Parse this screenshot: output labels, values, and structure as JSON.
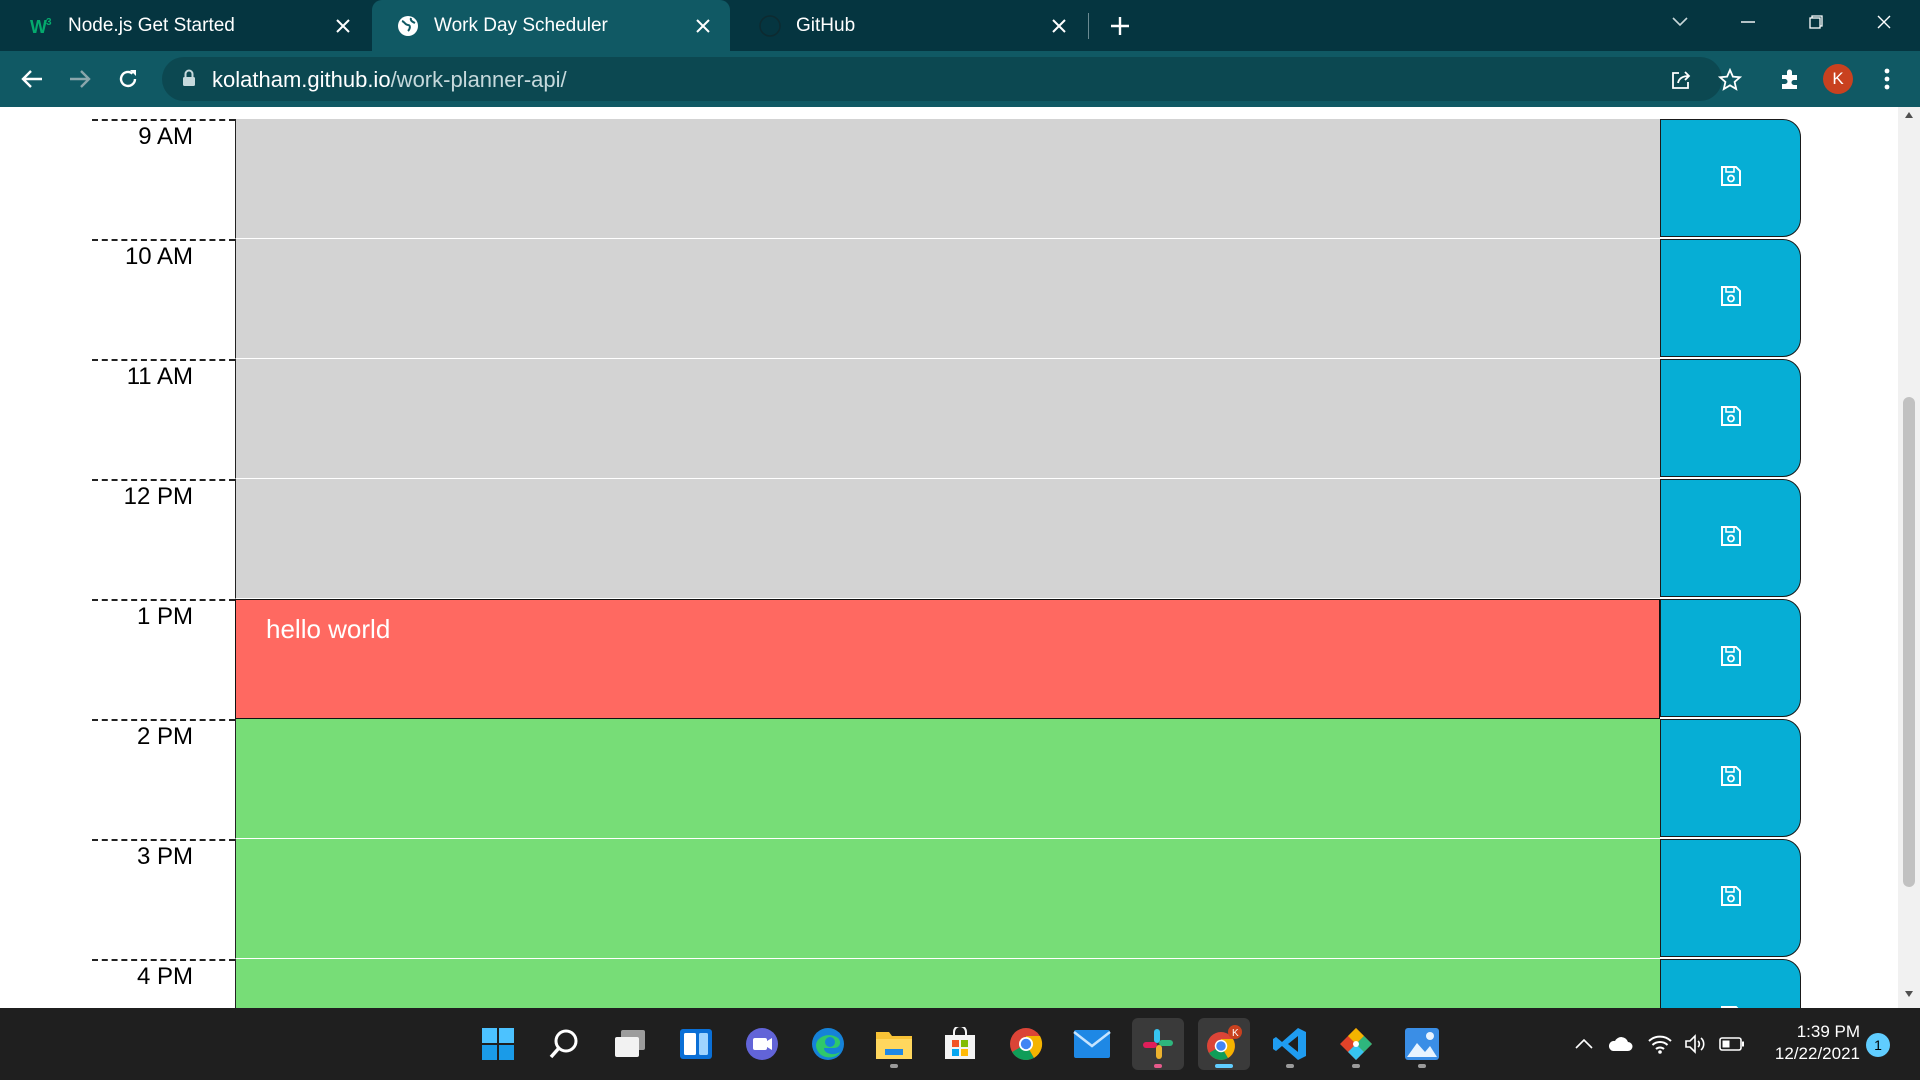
{
  "browser": {
    "tabs": [
      {
        "title": "Node.js Get Started",
        "favicon": "w3schools-icon",
        "active": false
      },
      {
        "title": "Work Day Scheduler",
        "favicon": "globe-icon",
        "active": true
      },
      {
        "title": "GitHub",
        "favicon": "github-icon",
        "active": false
      }
    ],
    "url_host": "kolatham.github.io",
    "url_path": "/work-planner-api/",
    "profile_initial": "K"
  },
  "scheduler": {
    "rows": [
      {
        "hour": "9 AM",
        "text": "",
        "state": "past"
      },
      {
        "hour": "10 AM",
        "text": "",
        "state": "past"
      },
      {
        "hour": "11 AM",
        "text": "",
        "state": "past"
      },
      {
        "hour": "12 PM",
        "text": "",
        "state": "past"
      },
      {
        "hour": "1 PM",
        "text": "hello world",
        "state": "present"
      },
      {
        "hour": "2 PM",
        "text": "",
        "state": "future"
      },
      {
        "hour": "3 PM",
        "text": "",
        "state": "future"
      },
      {
        "hour": "4 PM",
        "text": "",
        "state": "future"
      }
    ],
    "colors": {
      "past": "#d3d3d3",
      "present": "#ff6961",
      "future": "#77dd77",
      "save": "#06aed5"
    },
    "save_icon": "floppy-disk-icon"
  },
  "taskbar": {
    "apps": [
      "windows-start-icon",
      "search-icon",
      "task-view-icon",
      "widgets-icon",
      "teams-chat-icon",
      "edge-icon",
      "file-explorer-icon",
      "store-icon",
      "chrome-icon",
      "mail-icon",
      "slack-icon",
      "chrome-profile-icon",
      "vscode-icon",
      "git-icon",
      "photos-icon"
    ],
    "time": "1:39 PM",
    "date": "12/22/2021",
    "notification_count": "1"
  }
}
